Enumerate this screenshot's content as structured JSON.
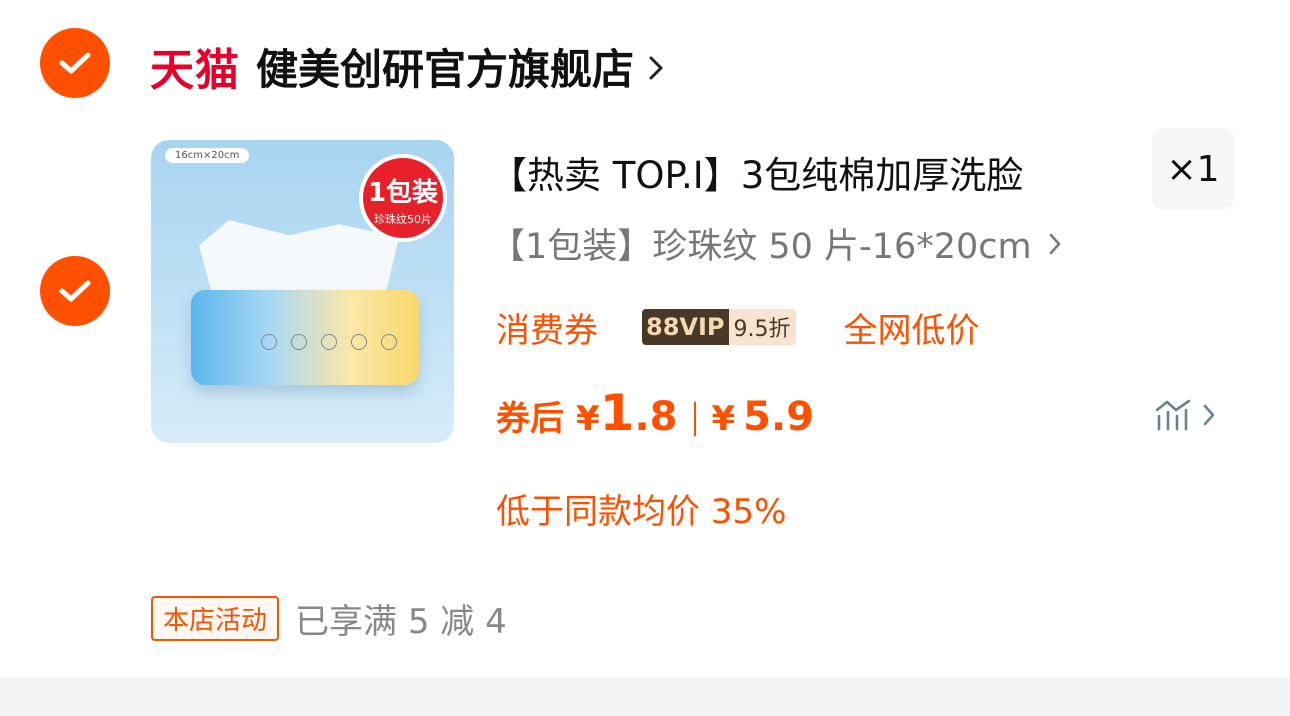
{
  "shop": {
    "brand": "天猫",
    "name": "健美创研官方旗舰店"
  },
  "product": {
    "image": {
      "size_tag": "16cm×20cm",
      "badge_big": "1包装",
      "badge_small": "珍珠纹50片"
    },
    "title": "【热卖 TOP.I】3包纯棉加厚洗脸",
    "quantity": "×1",
    "sku": "【1包装】珍珠纹 50 片-16*20cm",
    "promos": {
      "coupon": "消费券",
      "vip_label": "88VIP",
      "vip_discount": "9.5折",
      "lowest": "全网低价"
    },
    "price": {
      "after_coupon_label": "券后",
      "currency": "¥",
      "after_int": "1",
      "after_dec": ".8",
      "original": "5.9"
    },
    "below_average": "低于同款均价 35%"
  },
  "activity": {
    "tag": "本店活动",
    "text": "已享满 5 减 4"
  },
  "colors": {
    "accent": "#ff5000",
    "tmall_red": "#e8002a"
  }
}
